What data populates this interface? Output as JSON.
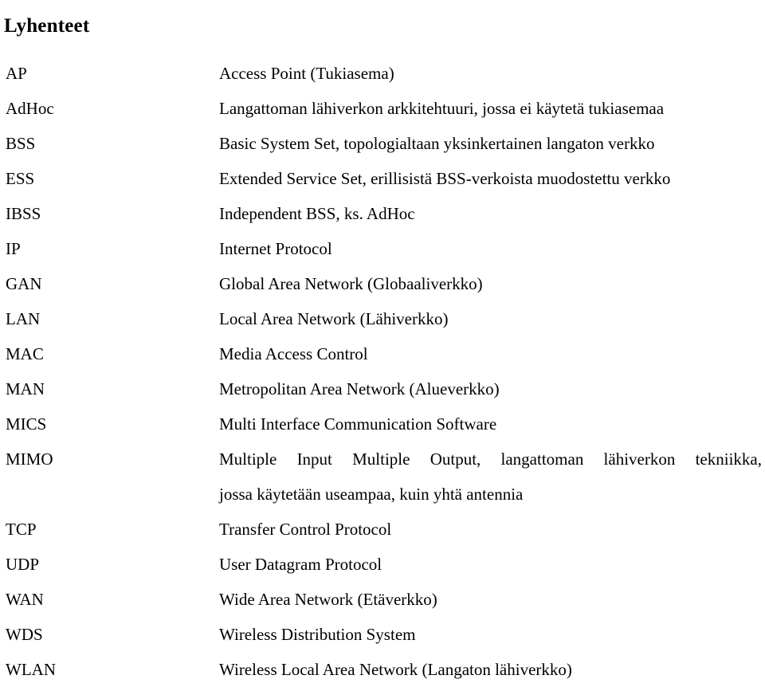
{
  "document": {
    "title": "Lyhenteet",
    "entries": [
      {
        "term": "AP",
        "definition": "Access Point (Tukiasema)",
        "lines": [
          "Access Point (Tukiasema)"
        ]
      },
      {
        "term": "AdHoc",
        "definition": "Langattoman lähiverkon arkkitehtuuri, jossa ei käytetä tukiasemaa",
        "lines": [
          "Langattoman lähiverkon arkkitehtuuri, jossa ei käytetä tukiasemaa"
        ]
      },
      {
        "term": "BSS",
        "definition": "Basic System Set, topologialtaan yksinkertainen langaton verkko",
        "lines": [
          "Basic System Set, topologialtaan yksinkertainen langaton verkko"
        ]
      },
      {
        "term": "ESS",
        "definition": "Extended Service Set, erillisistä BSS-verkoista muodostettu verkko",
        "lines": [
          "Extended Service Set, erillisistä BSS-verkoista muodostettu verkko"
        ]
      },
      {
        "term": "IBSS",
        "definition": "Independent BSS, ks. AdHoc",
        "lines": [
          "Independent BSS, ks. AdHoc"
        ]
      },
      {
        "term": "IP",
        "definition": "Internet Protocol",
        "lines": [
          "Internet Protocol"
        ]
      },
      {
        "term": "GAN",
        "definition": "Global Area Network (Globaaliverkko)",
        "lines": [
          "Global Area Network (Globaaliverkko)"
        ]
      },
      {
        "term": "LAN",
        "definition": "Local Area Network (Lähiverkko)",
        "lines": [
          "Local Area Network (Lähiverkko)"
        ]
      },
      {
        "term": "MAC",
        "definition": "Media Access Control",
        "lines": [
          "Media Access Control"
        ]
      },
      {
        "term": "MAN",
        "definition": "Metropolitan Area Network (Alueverkko)",
        "lines": [
          "Metropolitan Area Network (Alueverkko)"
        ]
      },
      {
        "term": "MICS",
        "definition": "Multi Interface Communication Software",
        "lines": [
          "Multi Interface Communication Software"
        ]
      },
      {
        "term": "MIMO",
        "definition": "Multiple Input Multiple Output, langattoman lähiverkon tekniikka, jossa käytetään useampaa, kuin yhtä antennia",
        "lines": [
          "Multiple Input Multiple Output, langattoman lähiverkon tekniikka,",
          "jossa käytetään useampaa, kuin yhtä antennia"
        ]
      },
      {
        "term": "TCP",
        "definition": "Transfer Control Protocol",
        "lines": [
          "Transfer Control Protocol"
        ]
      },
      {
        "term": "UDP",
        "definition": "User Datagram Protocol",
        "lines": [
          "User Datagram Protocol"
        ]
      },
      {
        "term": "WAN",
        "definition": "Wide Area Network (Etäverkko)",
        "lines": [
          "Wide Area Network (Etäverkko)"
        ]
      },
      {
        "term": "WDS",
        "definition": "Wireless Distribution System",
        "lines": [
          "Wireless Distribution System"
        ]
      },
      {
        "term": "WLAN",
        "definition": "Wireless Local Area Network (Langaton lähiverkko)",
        "lines": [
          "Wireless Local Area Network (Langaton lähiverkko)"
        ]
      }
    ]
  },
  "colors": {
    "text": "#000000",
    "background": "#ffffff"
  }
}
